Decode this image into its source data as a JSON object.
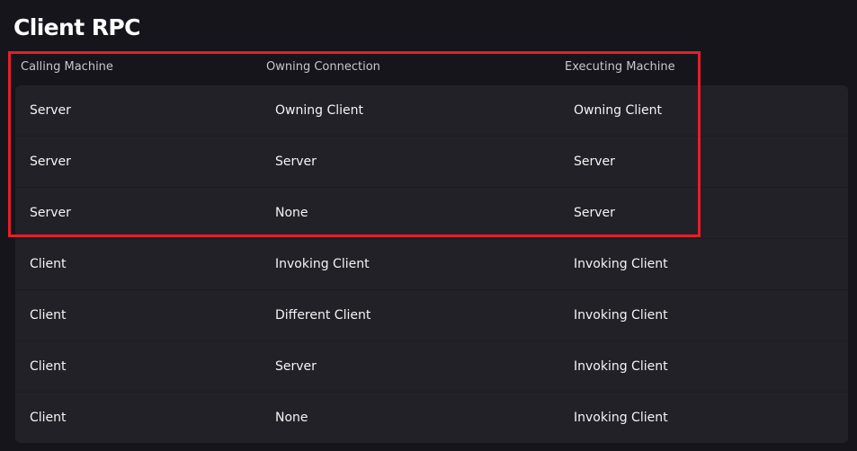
{
  "page": {
    "title": "Client RPC"
  },
  "table": {
    "headers": [
      "Calling Machine",
      "Owning Connection",
      "Executing Machine"
    ],
    "rows": [
      [
        "Server",
        "Owning Client",
        "Owning Client"
      ],
      [
        "Server",
        "Server",
        "Server"
      ],
      [
        "Server",
        "None",
        "Server"
      ],
      [
        "Client",
        "Invoking Client",
        "Invoking Client"
      ],
      [
        "Client",
        "Different Client",
        "Invoking Client"
      ],
      [
        "Client",
        "Server",
        "Invoking Client"
      ],
      [
        "Client",
        "None",
        "Invoking Client"
      ]
    ]
  },
  "highlight": {
    "color": "#e3202a",
    "covers_rows": [
      0,
      1,
      2
    ]
  },
  "colors": {
    "background": "#16151b",
    "row_background": "#222127",
    "header_text": "#c8c8cc",
    "cell_text": "#f4f4f6"
  }
}
